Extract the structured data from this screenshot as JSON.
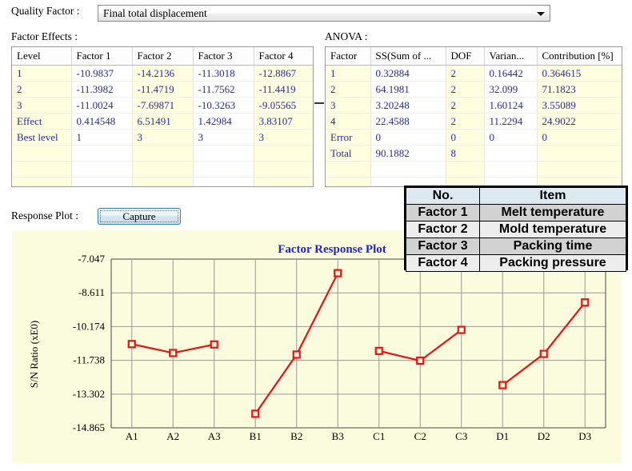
{
  "quality_factor": {
    "label": "Quality Factor :",
    "selected": "Final total displacement",
    "arrow_icon": "chevron-down-icon"
  },
  "factor_effects": {
    "caption": "Factor Effects :",
    "columns": [
      "Level",
      "Factor 1",
      "Factor 2",
      "Factor 3",
      "Factor 4"
    ],
    "rows": [
      [
        "1",
        "-10.9837",
        "-14.2136",
        "-11.3018",
        "-12.8867"
      ],
      [
        "2",
        "-11.3982",
        "-11.4719",
        "-11.7562",
        "-11.4419"
      ],
      [
        "3",
        "-11.0024",
        "-7.69871",
        "-10.3263",
        "-9.05565"
      ],
      [
        "Effect",
        "0.414548",
        "6.51491",
        "1.42984",
        "3.83107"
      ],
      [
        "Best level",
        "1",
        "3",
        "3",
        "3"
      ],
      [
        "",
        "",
        "",
        "",
        ""
      ],
      [
        "",
        "",
        "",
        "",
        ""
      ],
      [
        "",
        "",
        "",
        "",
        ""
      ]
    ]
  },
  "anova": {
    "caption": "ANOVA :",
    "columns": [
      "Factor",
      "SS(Sum of ...",
      "DOF",
      "Varian...",
      "Contribution [%]"
    ],
    "rows": [
      [
        "1",
        "0.32884",
        "2",
        "0.16442",
        "0.364615"
      ],
      [
        "2",
        "64.1981",
        "2",
        "32.099",
        "71.1823"
      ],
      [
        "3",
        "3.20248",
        "2",
        "1.60124",
        "3.55089"
      ],
      [
        "4",
        "22.4588",
        "2",
        "11.2294",
        "24.9022"
      ],
      [
        "Error",
        "0",
        "0",
        "0",
        "0"
      ],
      [
        "Total",
        "90.1882",
        "8",
        "",
        ""
      ],
      [
        "",
        "",
        "",
        "",
        ""
      ],
      [
        "",
        "",
        "",
        "",
        ""
      ]
    ]
  },
  "response_plot": {
    "caption": "Response Plot :",
    "capture_label": "Capture"
  },
  "overlay_legend": {
    "columns": [
      "No.",
      "Item"
    ],
    "rows": [
      [
        "Factor 1",
        "Melt temperature"
      ],
      [
        "Factor 2",
        "Mold temperature"
      ],
      [
        "Factor 3",
        "Packing time"
      ],
      [
        "Factor 4",
        "Packing pressure"
      ]
    ]
  },
  "colors": {
    "series": "#ee1111",
    "title": "#2222dd",
    "grid_text": "#2a2aa8",
    "plot_background": "#fbfbdd",
    "gridline": "#9a9a9a",
    "cell_alt": "#ffffe0"
  },
  "chart_data": {
    "type": "line",
    "title": "Factor Response Plot",
    "xlabel": "",
    "ylabel": "S/N Ratio (xE0)",
    "categories": [
      "A1",
      "A2",
      "A3",
      "B1",
      "B2",
      "B3",
      "C1",
      "C2",
      "C3",
      "D1",
      "D2",
      "D3"
    ],
    "ytick_labels": [
      "-7.047",
      "-8.611",
      "-10.174",
      "-11.738",
      "-13.302",
      "-14.865"
    ],
    "ytick_values": [
      -7.047,
      -8.611,
      -10.174,
      -11.738,
      -13.302,
      -14.865
    ],
    "ylim": [
      -14.865,
      -7.047
    ],
    "grid": true,
    "legend": "none",
    "marker": "open-square",
    "series": [
      {
        "name": "S/N Ratio",
        "segments": [
          {
            "factor": "Factor 1",
            "x": [
              "A1",
              "A2",
              "A3"
            ],
            "values": [
              -10.9837,
              -11.3982,
              -11.0024
            ]
          },
          {
            "factor": "Factor 2",
            "x": [
              "B1",
              "B2",
              "B3"
            ],
            "values": [
              -14.2136,
              -11.4719,
              -7.69871
            ]
          },
          {
            "factor": "Factor 3",
            "x": [
              "C1",
              "C2",
              "C3"
            ],
            "values": [
              -11.3018,
              -11.7562,
              -10.3263
            ]
          },
          {
            "factor": "Factor 4",
            "x": [
              "D1",
              "D2",
              "D3"
            ],
            "values": [
              -12.8867,
              -11.4419,
              -9.05565
            ]
          }
        ]
      }
    ]
  }
}
